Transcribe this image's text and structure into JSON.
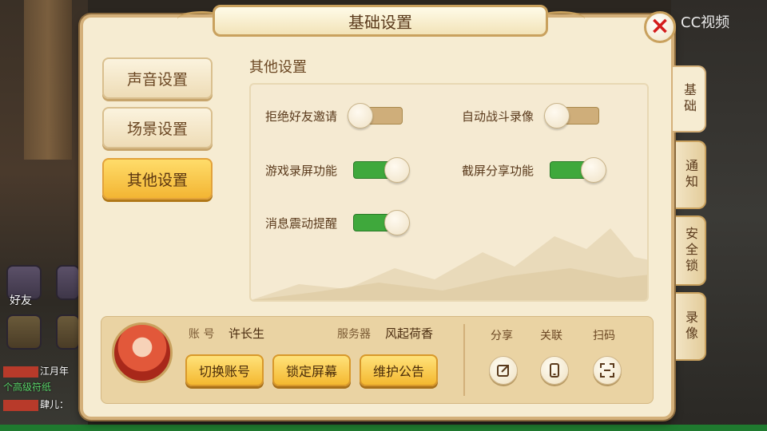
{
  "window": {
    "title": "基础设置",
    "close_symbol": "×"
  },
  "watermark": "CC视频",
  "menu": [
    {
      "label": "声音设置",
      "active": false
    },
    {
      "label": "场景设置",
      "active": false
    },
    {
      "label": "其他设置",
      "active": true
    }
  ],
  "section_title": "其他设置",
  "settings": [
    {
      "label": "拒绝好友邀请",
      "on": false
    },
    {
      "label": "自动战斗录像",
      "on": false
    },
    {
      "label": "游戏录屏功能",
      "on": true
    },
    {
      "label": "截屏分享功能",
      "on": true
    },
    {
      "label": "消息震动提醒",
      "on": true
    }
  ],
  "account": {
    "account_label": "账 号",
    "account_value": "许长生",
    "server_label": "服务器",
    "server_value": "风起荷香"
  },
  "actions": [
    "切换账号",
    "锁定屏幕",
    "维护公告"
  ],
  "share_actions": [
    {
      "label": "分享",
      "icon": "share-icon"
    },
    {
      "label": "关联",
      "icon": "phone-icon"
    },
    {
      "label": "扫码",
      "icon": "scan-icon"
    }
  ],
  "tabs": [
    {
      "label": "基础",
      "active": true
    },
    {
      "label": "通知",
      "active": false
    },
    {
      "label": "安全锁",
      "active": false
    },
    {
      "label": "录像",
      "active": false
    }
  ],
  "side": {
    "friends_label": "好友",
    "chat_lines": [
      {
        "rank": "",
        "text": "江月年"
      },
      {
        "rank": "高级",
        "text": "个高级符纸"
      },
      {
        "rank": "",
        "text": "肆儿："
      }
    ]
  },
  "colors": {
    "accent": "#f4b830",
    "toggle_on": "#3fa83c",
    "toggle_off": "#cfae7a",
    "close": "#d41c1c"
  }
}
